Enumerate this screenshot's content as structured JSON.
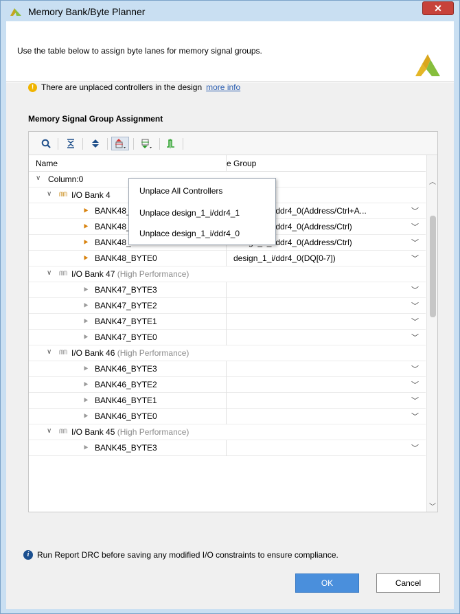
{
  "window": {
    "title": "Memory Bank/Byte Planner",
    "close_glyph": "✕"
  },
  "header": {
    "description": "Use the table below to assign byte lanes for memory signal groups."
  },
  "warning": {
    "icon_glyph": "!",
    "text": "There are unplaced controllers in the design",
    "link": "more info"
  },
  "section": {
    "title": "Memory Signal Group Assignment"
  },
  "toolbar": {
    "icons": [
      "search-icon",
      "collapse-all-icon",
      "expand-all-icon",
      "unplace-icon",
      "auto-place-icon",
      "signal-icon"
    ]
  },
  "table": {
    "columns": [
      "Name",
      "e Group"
    ],
    "rows": [
      {
        "level": 0,
        "type": "column",
        "name": "Column:0"
      },
      {
        "level": 1,
        "type": "bank",
        "name": "I/O Bank 4",
        "perf": "",
        "active": true
      },
      {
        "level": 2,
        "type": "byte",
        "name": "BANK48_BYTE3",
        "value": "design_1_i/ddr4_0(Address/Ctrl+A...",
        "active": true
      },
      {
        "level": 2,
        "type": "byte",
        "name": "BANK48_BYTE2",
        "value": "design_1_i/ddr4_0(Address/Ctrl)",
        "active": true
      },
      {
        "level": 2,
        "type": "byte",
        "name": "BANK48_BYTE1",
        "value": "design_1_i/ddr4_0(Address/Ctrl)",
        "active": true
      },
      {
        "level": 2,
        "type": "byte",
        "name": "BANK48_BYTE0",
        "value": "design_1_i/ddr4_0(DQ[0-7])",
        "active": true
      },
      {
        "level": 1,
        "type": "bank",
        "name": "I/O Bank 47",
        "perf": "(High Performance)",
        "active": false
      },
      {
        "level": 2,
        "type": "byte",
        "name": "BANK47_BYTE3",
        "value": "",
        "active": false
      },
      {
        "level": 2,
        "type": "byte",
        "name": "BANK47_BYTE2",
        "value": "",
        "active": false
      },
      {
        "level": 2,
        "type": "byte",
        "name": "BANK47_BYTE1",
        "value": "",
        "active": false
      },
      {
        "level": 2,
        "type": "byte",
        "name": "BANK47_BYTE0",
        "value": "",
        "active": false
      },
      {
        "level": 1,
        "type": "bank",
        "name": "I/O Bank 46",
        "perf": "(High Performance)",
        "active": false
      },
      {
        "level": 2,
        "type": "byte",
        "name": "BANK46_BYTE3",
        "value": "",
        "active": false
      },
      {
        "level": 2,
        "type": "byte",
        "name": "BANK46_BYTE2",
        "value": "",
        "active": false
      },
      {
        "level": 2,
        "type": "byte",
        "name": "BANK46_BYTE1",
        "value": "",
        "active": false
      },
      {
        "level": 2,
        "type": "byte",
        "name": "BANK46_BYTE0",
        "value": "",
        "active": false
      },
      {
        "level": 1,
        "type": "bank",
        "name": "I/O Bank 45",
        "perf": "(High Performance)",
        "active": false
      },
      {
        "level": 2,
        "type": "byte",
        "name": "BANK45_BYTE3",
        "value": "",
        "active": false
      }
    ]
  },
  "popup_menu": {
    "items": [
      "Unplace All Controllers",
      "Unplace design_1_i/ddr4_1",
      "Unplace design_1_i/ddr4_0"
    ]
  },
  "info": {
    "icon_glyph": "i",
    "text": "Run Report DRC before saving any modified I/O constraints to ensure compliance."
  },
  "buttons": {
    "ok": "OK",
    "cancel": "Cancel"
  }
}
